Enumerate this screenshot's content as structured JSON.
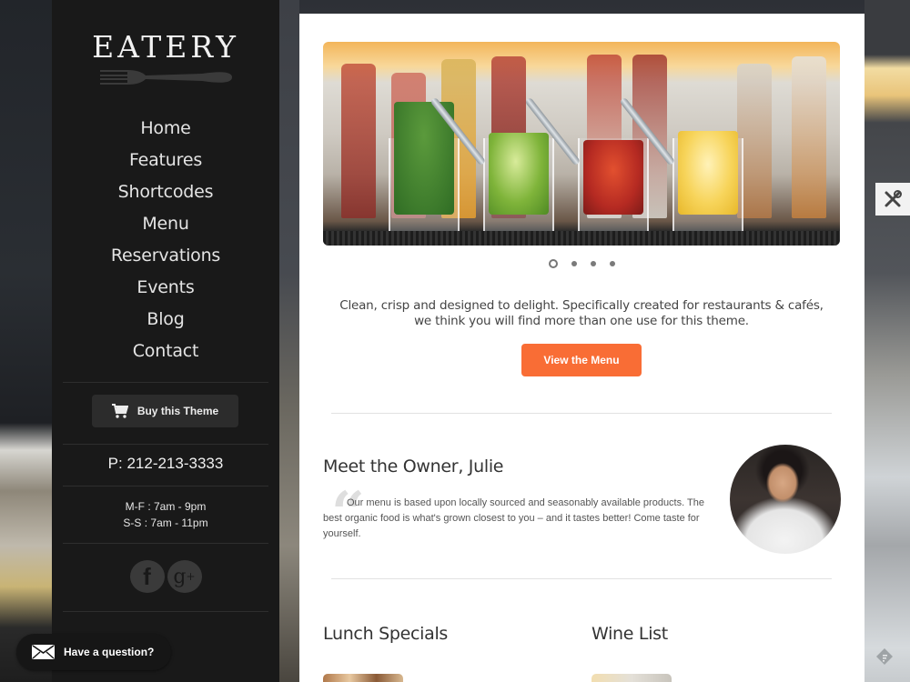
{
  "brand": {
    "logo_text": "EATERY",
    "accent_color": "#f96d35",
    "sidebar_bg": "#191919"
  },
  "nav": {
    "items": [
      {
        "label": "Home"
      },
      {
        "label": "Features"
      },
      {
        "label": "Shortcodes"
      },
      {
        "label": "Menu"
      },
      {
        "label": "Reservations"
      },
      {
        "label": "Events"
      },
      {
        "label": "Blog"
      },
      {
        "label": "Contact"
      }
    ]
  },
  "sidebar": {
    "buy_button": {
      "label": "Buy this Theme",
      "icon": "cart-icon"
    },
    "phone": "P: 212-213-3333",
    "hours": [
      "M-F : 7am - 9pm",
      "S-S : 7am - 11pm"
    ],
    "social": [
      {
        "name": "facebook",
        "glyph": "f",
        "icon": "facebook-icon"
      },
      {
        "name": "google-plus",
        "glyph": "g",
        "sup": "+",
        "icon": "google-plus-icon"
      }
    ]
  },
  "question_widget": {
    "label": "Have a question?",
    "icon": "mail-icon"
  },
  "slider": {
    "slide_count": 4,
    "active_index": 0,
    "image_alt": "Four glasses of cocktail garnishes: mint, lime, strawberries, lemon"
  },
  "intro": {
    "text": "Clean, crisp and designed to delight. Specifically created for restaurants & cafés, we think you will find more than one use for this theme.",
    "cta_label": "View the Menu"
  },
  "owner": {
    "title": "Meet the Owner, Julie",
    "quote_mark": "“",
    "quote": "Our menu is based upon locally sourced and seasonably available products. The best organic food is what's grown closest to you – and it tastes better! Come taste for yourself."
  },
  "sections": [
    {
      "title": "Lunch Specials"
    },
    {
      "title": "Wine List"
    }
  ],
  "floating": {
    "tools_icon": "tools-icon",
    "feedly_icon": "feedly-icon"
  }
}
